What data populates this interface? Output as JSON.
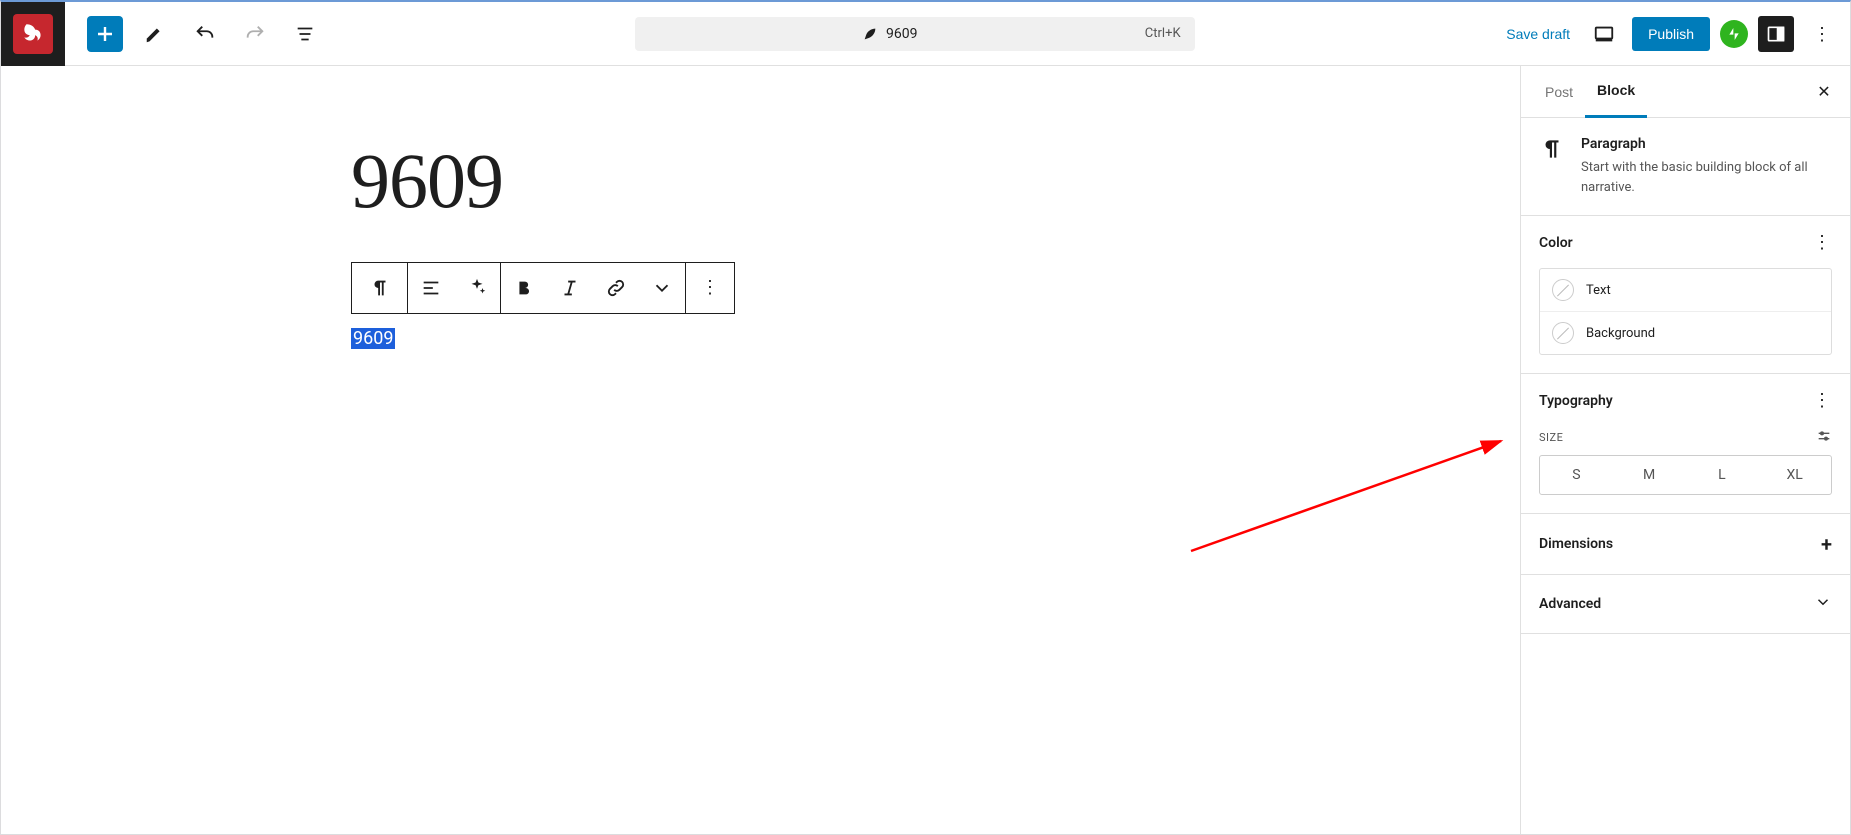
{
  "topbar": {
    "doc_title": "9609",
    "hotkey": "Ctrl+K",
    "save_draft": "Save draft",
    "publish": "Publish"
  },
  "editor": {
    "title": "9609",
    "paragraph_text": "9609"
  },
  "sidebar": {
    "tabs": {
      "post": "Post",
      "block": "Block"
    },
    "block_info": {
      "name": "Paragraph",
      "description": "Start with the basic building block of all narrative."
    },
    "color": {
      "heading": "Color",
      "items": {
        "text": "Text",
        "background": "Background"
      }
    },
    "typography": {
      "heading": "Typography",
      "size_label": "SIZE",
      "sizes": [
        "S",
        "M",
        "L",
        "XL"
      ]
    },
    "dimensions": {
      "heading": "Dimensions"
    },
    "advanced": {
      "heading": "Advanced"
    }
  }
}
